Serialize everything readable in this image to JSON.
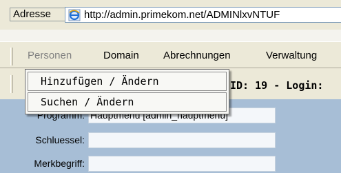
{
  "address_bar": {
    "label": "Adresse",
    "url": "http://admin.primekom.net/ADMINlxvNTUF"
  },
  "menu": {
    "items": [
      "Personen",
      "Domain",
      "Abrechnungen",
      "Verwaltung"
    ]
  },
  "dropdown": {
    "items": [
      "Hinzufügen / Ändern",
      "Suchen / Ändern"
    ]
  },
  "info_bar": {
    "text": "ID: 19 - Login:"
  },
  "form": {
    "program_label": "Programm:",
    "program_value": "Hauptmenü [admin_hauptmenu]",
    "schluessel_label": "Schluessel:",
    "schluessel_value": "",
    "merkbegriff_label": "Merkbegriff:",
    "merkbegriff_value": ""
  },
  "colors": {
    "toolbar": "#ece9d8",
    "content": "#a7bed6"
  }
}
